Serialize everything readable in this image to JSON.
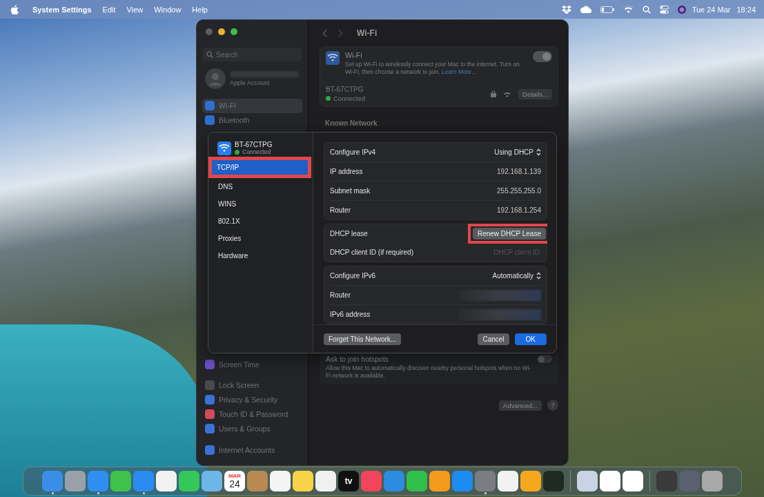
{
  "menu_bar": {
    "app": "System Settings",
    "menus": [
      "Edit",
      "View",
      "Window",
      "Help"
    ],
    "date": "Tue 24 Mar",
    "time": "18:24"
  },
  "window": {
    "title": "Wi-Fi",
    "sidebar": {
      "search_placeholder": "Search",
      "account_subtitle": "Apple Account",
      "items": [
        {
          "label": "Wi-Fi",
          "selected": true,
          "color": "#2f6fd0"
        },
        {
          "label": "Bluetooth",
          "selected": false,
          "color": "#2f6fd0"
        },
        {
          "label": "Screen Time",
          "selected": false,
          "color": "#6a4fc8"
        },
        {
          "label": "Lock Screen",
          "selected": false,
          "color": "#4a4a4e"
        },
        {
          "label": "Privacy & Security",
          "selected": false,
          "color": "#3a72d8"
        },
        {
          "label": "Touch ID & Password",
          "selected": false,
          "color": "#d04a5a"
        },
        {
          "label": "Users & Groups",
          "selected": false,
          "color": "#3a72d8"
        },
        {
          "label": "Internet Accounts",
          "selected": false,
          "color": "#3a72d8"
        }
      ]
    },
    "wifi_card": {
      "title": "Wi-Fi",
      "description": "Set up Wi-Fi to wirelessly connect your Mac to the internet. Turn on Wi-Fi, then choose a network to join.",
      "link": "Learn More...",
      "on": true,
      "network": "BT-67CTPG",
      "status": "Connected",
      "details_button": "Details..."
    },
    "known_heading": "Known Network",
    "hotspots": {
      "title": "Ask to join hotspots",
      "description": "Allow this Mac to automatically discover nearby personal hotspots when no Wi-Fi network is available.",
      "on": false
    },
    "advanced_button": "Advanced...",
    "help_button": "?"
  },
  "dialog": {
    "network": "BT-67CTPG",
    "status": "Connected",
    "tabs": [
      {
        "label": "TCP/IP",
        "selected": true,
        "highlighted": true
      },
      {
        "label": "DNS",
        "selected": false,
        "highlighted": false
      },
      {
        "label": "WINS",
        "selected": false,
        "highlighted": false
      },
      {
        "label": "802.1X",
        "selected": false,
        "highlighted": false
      },
      {
        "label": "Proxies",
        "selected": false,
        "highlighted": false
      },
      {
        "label": "Hardware",
        "selected": false,
        "highlighted": false
      }
    ],
    "groups": [
      [
        {
          "kind": "popup",
          "label": "Configure IPv4",
          "value": "Using DHCP"
        },
        {
          "kind": "value",
          "label": "IP address",
          "value": "192.168.1.139"
        },
        {
          "kind": "value",
          "label": "Subnet mask",
          "value": "255.255.255.0"
        },
        {
          "kind": "value",
          "label": "Router",
          "value": "192.168.1.254"
        }
      ],
      [
        {
          "kind": "button",
          "label": "DHCP lease",
          "value": "Renew DHCP Lease",
          "highlighted": true
        },
        {
          "kind": "field",
          "label": "DHCP client ID (if required)",
          "placeholder": "DHCP client ID"
        }
      ],
      [
        {
          "kind": "popup",
          "label": "Configure IPv6",
          "value": "Automatically"
        },
        {
          "kind": "blurred",
          "label": "Router"
        },
        {
          "kind": "blurred",
          "label": "IPv6 address"
        }
      ]
    ],
    "forget_button": "Forget This Network...",
    "cancel_button": "Cancel",
    "ok_button": "OK"
  },
  "dock": [
    {
      "kind": "app",
      "color": "#3b8ee8",
      "running": true
    },
    {
      "kind": "app",
      "color": "#9aa0aa",
      "running": false
    },
    {
      "kind": "app",
      "color": "#2f8ef0",
      "running": true
    },
    {
      "kind": "app",
      "color": "#3ec24c",
      "running": false
    },
    {
      "kind": "app",
      "color": "#2a8cf0",
      "running": true
    },
    {
      "kind": "app",
      "color": "#f2f2f2",
      "running": false
    },
    {
      "kind": "app",
      "color": "#34c759",
      "running": false
    },
    {
      "kind": "app",
      "color": "#6cb6e8",
      "running": false
    },
    {
      "kind": "calendar",
      "month": "MAR",
      "day": "24",
      "running": false
    },
    {
      "kind": "app",
      "color": "#b88a52",
      "running": false
    },
    {
      "kind": "app",
      "color": "#f4f4f4",
      "running": false
    },
    {
      "kind": "app",
      "color": "#f7d348",
      "running": false
    },
    {
      "kind": "app",
      "color": "#f0f0f0",
      "running": false
    },
    {
      "kind": "label",
      "label": "tv",
      "running": false
    },
    {
      "kind": "app",
      "color": "#f0455a",
      "running": false
    },
    {
      "kind": "app",
      "color": "#2c8ce0",
      "running": false
    },
    {
      "kind": "app",
      "color": "#2fbf4a",
      "running": false
    },
    {
      "kind": "app",
      "color": "#f59a1c",
      "running": false
    },
    {
      "kind": "app",
      "color": "#1c8cf0",
      "running": false
    },
    {
      "kind": "app",
      "color": "#7a7d82",
      "running": true
    },
    {
      "kind": "app",
      "color": "#f2f2f2",
      "running": false
    },
    {
      "kind": "app",
      "color": "#f6a81c",
      "running": false
    },
    {
      "kind": "app",
      "color": "#1e2a22",
      "running": false
    },
    {
      "kind": "separator"
    },
    {
      "kind": "app",
      "color": "#c8d4e4",
      "running": false
    },
    {
      "kind": "app",
      "color": "#ffffff",
      "running": false
    },
    {
      "kind": "app",
      "color": "#ffffff",
      "running": false
    },
    {
      "kind": "separator"
    },
    {
      "kind": "app",
      "color": "#3a3a3a",
      "running": false
    },
    {
      "kind": "app",
      "color": "#5a6070",
      "running": false
    },
    {
      "kind": "app",
      "color": "#a8a8a8",
      "running": false
    }
  ]
}
